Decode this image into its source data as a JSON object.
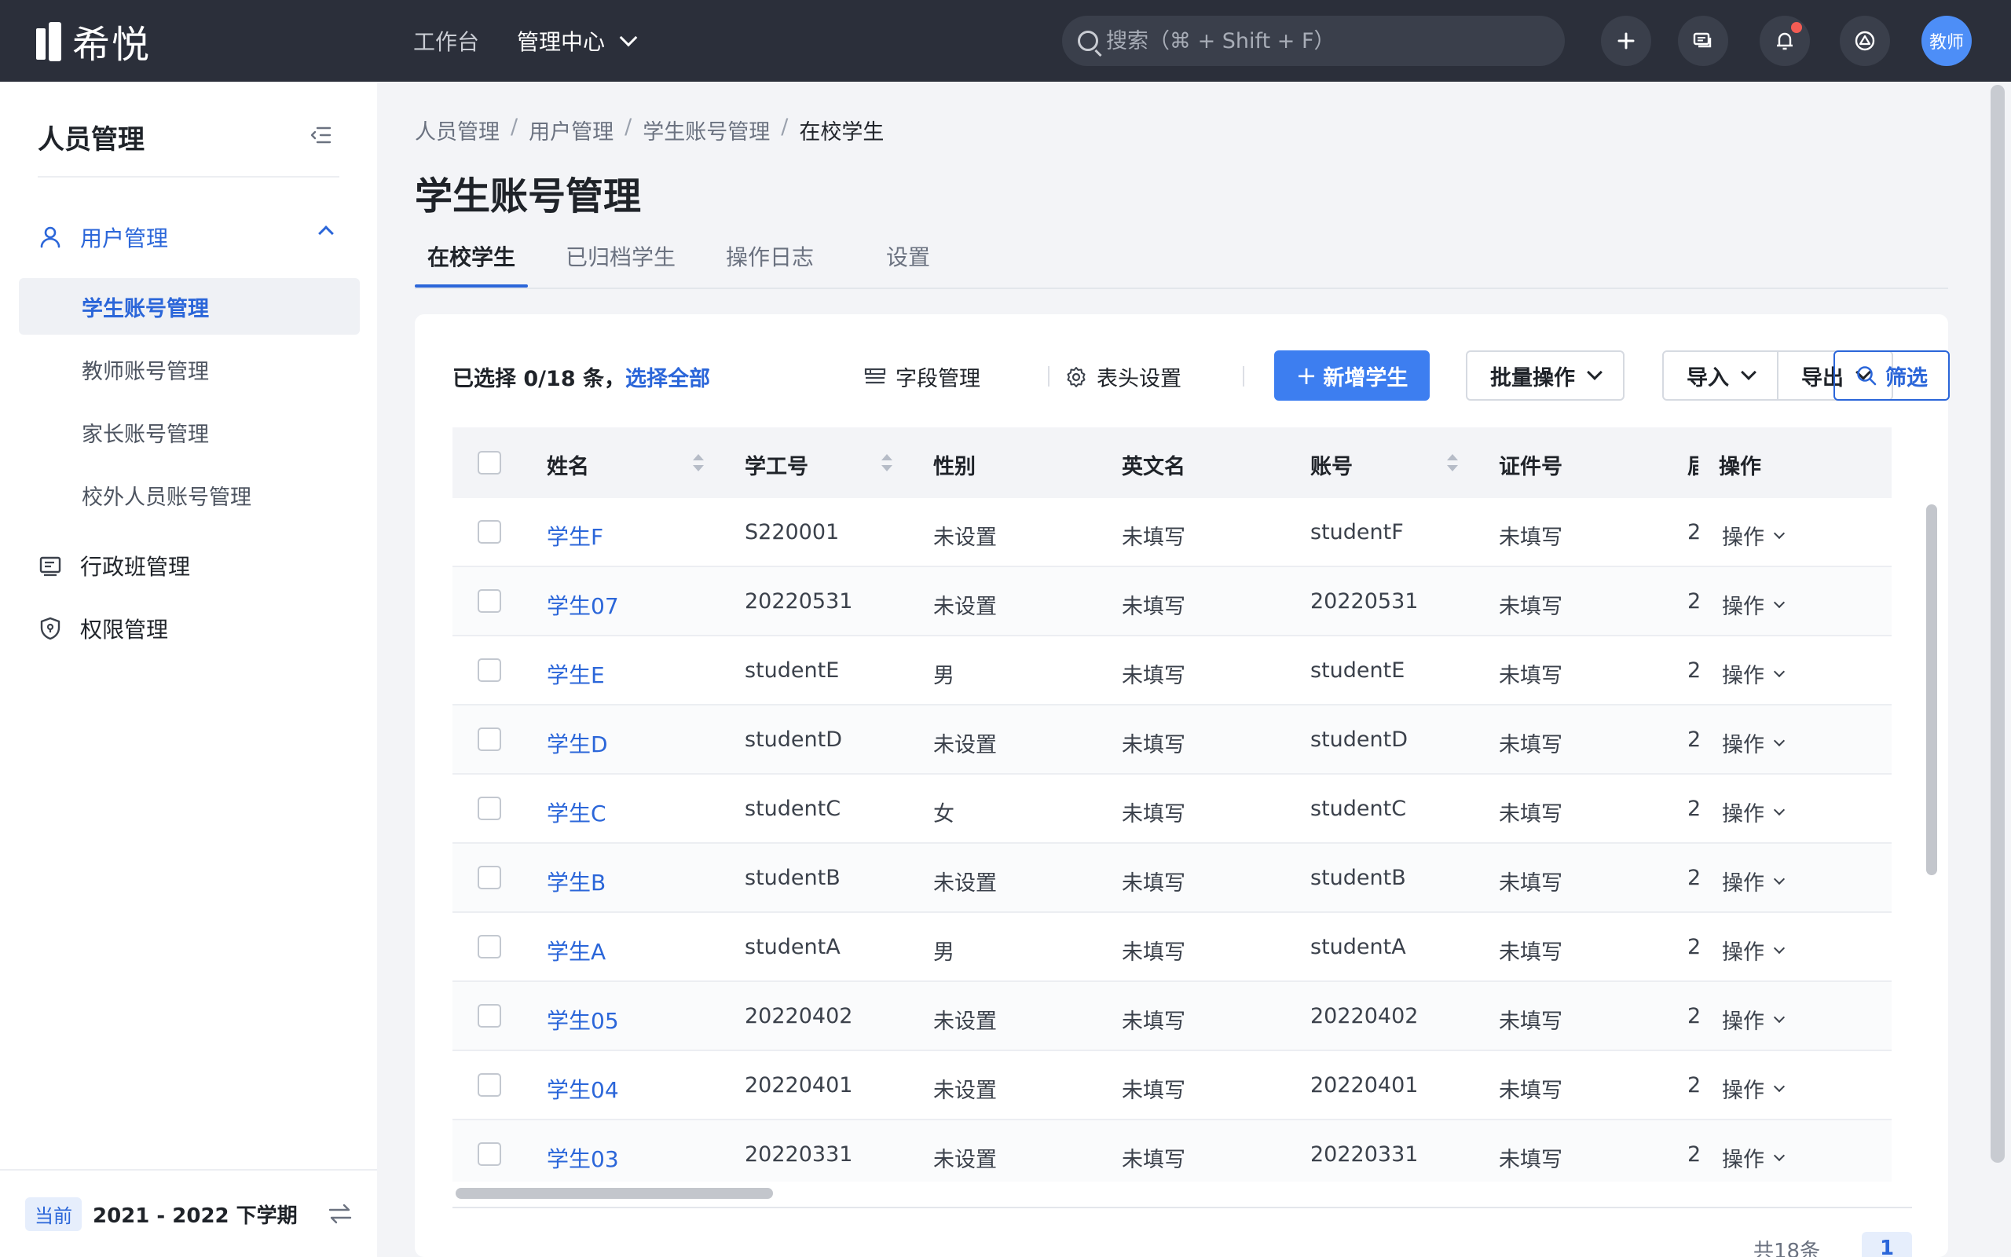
{
  "app": {
    "logo_text": "希悦"
  },
  "topnav": {
    "items": [
      "工作台",
      "管理中心"
    ]
  },
  "search": {
    "placeholder": "搜索（⌘ + Shift + F）"
  },
  "avatar": {
    "label": "教师"
  },
  "sidebar": {
    "title": "人员管理",
    "groups": [
      {
        "label": "用户管理",
        "icon": "user-icon",
        "expanded": true
      },
      {
        "label": "行政班管理",
        "icon": "class-icon"
      },
      {
        "label": "权限管理",
        "icon": "shield-icon"
      }
    ],
    "sub_items": [
      "学生账号管理",
      "教师账号管理",
      "家长账号管理",
      "校外人员账号管理"
    ],
    "active_sub": "学生账号管理",
    "footer": {
      "badge": "当前",
      "term": "2021 - 2022 下学期"
    }
  },
  "breadcrumb": [
    "人员管理",
    "用户管理",
    "学生账号管理",
    "在校学生"
  ],
  "page_title": "学生账号管理",
  "tabs": [
    "在校学生",
    "已归档学生",
    "操作日志",
    "设置"
  ],
  "toolbar": {
    "selected_text": "已选择 0/18 条，",
    "select_all": "选择全部",
    "field_mgmt": "字段管理",
    "header_settings": "表头设置",
    "add_student": "新增学生",
    "batch": "批量操作",
    "import": "导入",
    "export": "导出",
    "filter": "筛选"
  },
  "table": {
    "headers": [
      "姓名",
      "学工号",
      "性别",
      "英文名",
      "账号",
      "证件号",
      "届",
      "操作"
    ],
    "rows": [
      {
        "name": "学生F",
        "id": "S220001",
        "gender": "未设置",
        "en": "未填写",
        "account": "studentF",
        "cert": "未填写",
        "grade": "2",
        "op": "操作"
      },
      {
        "name": "学生07",
        "id": "20220531",
        "gender": "未设置",
        "en": "未填写",
        "account": "20220531",
        "cert": "未填写",
        "grade": "2",
        "op": "操作"
      },
      {
        "name": "学生E",
        "id": "studentE",
        "gender": "男",
        "en": "未填写",
        "account": "studentE",
        "cert": "未填写",
        "grade": "2",
        "op": "操作"
      },
      {
        "name": "学生D",
        "id": "studentD",
        "gender": "未设置",
        "en": "未填写",
        "account": "studentD",
        "cert": "未填写",
        "grade": "2",
        "op": "操作"
      },
      {
        "name": "学生C",
        "id": "studentC",
        "gender": "女",
        "en": "未填写",
        "account": "studentC",
        "cert": "未填写",
        "grade": "2",
        "op": "操作"
      },
      {
        "name": "学生B",
        "id": "studentB",
        "gender": "未设置",
        "en": "未填写",
        "account": "studentB",
        "cert": "未填写",
        "grade": "2",
        "op": "操作"
      },
      {
        "name": "学生A",
        "id": "studentA",
        "gender": "男",
        "en": "未填写",
        "account": "studentA",
        "cert": "未填写",
        "grade": "2",
        "op": "操作"
      },
      {
        "name": "学生05",
        "id": "20220402",
        "gender": "未设置",
        "en": "未填写",
        "account": "20220402",
        "cert": "未填写",
        "grade": "2",
        "op": "操作"
      },
      {
        "name": "学生04",
        "id": "20220401",
        "gender": "未设置",
        "en": "未填写",
        "account": "20220401",
        "cert": "未填写",
        "grade": "2",
        "op": "操作"
      },
      {
        "name": "学生03",
        "id": "20220331",
        "gender": "未设置",
        "en": "未填写",
        "account": "20220331",
        "cert": "未填写",
        "grade": "2",
        "op": "操作"
      }
    ]
  },
  "pagination": {
    "total": "共18条",
    "current": "1"
  }
}
